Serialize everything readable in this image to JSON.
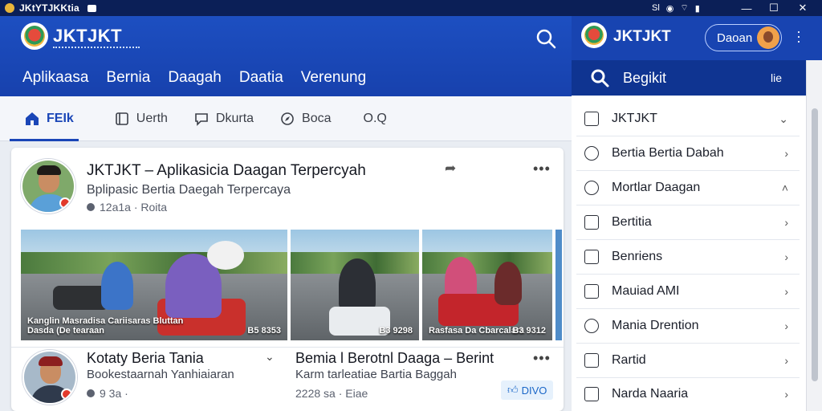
{
  "window": {
    "title": "JKtYTJKKtia",
    "tray": [
      "Sl",
      "wifi",
      "signal"
    ]
  },
  "header": {
    "brand": "JKTJKT",
    "nav": [
      "Aplikaasa",
      "Bernia",
      "Daagah",
      "Daatia",
      "Verenung"
    ]
  },
  "tabs": [
    {
      "label": "FEIk",
      "icon": "home-icon",
      "active": true
    },
    {
      "label": "Uerth",
      "icon": "doc-icon",
      "active": false
    },
    {
      "label": "Dkurta",
      "icon": "comment-icon",
      "active": false
    },
    {
      "label": "Boca",
      "icon": "compass-icon",
      "active": false
    },
    {
      "label": "O.Q",
      "icon": "",
      "active": false
    }
  ],
  "post1": {
    "title": "JKTJKT – Aplikasicia Daagan Terpercyah",
    "subtitle": "Bplipasic Bertia Daegah Terpercaya",
    "meta": "12a1a · Roita",
    "photos": [
      {
        "caption": "Kanglin Masradisa Cariisaras Bluttan",
        "caption2": "Dasda (De tearaan",
        "number": "B5 8353"
      },
      {
        "caption": "",
        "number": "B3 9298"
      },
      {
        "caption": "Rasfasa Da Cbarcalara",
        "number": "B3 9312"
      }
    ]
  },
  "post2": {
    "left": {
      "title": "Kotaty Beria Tania",
      "subtitle": "Bookestaarnah Yanhiaiaran",
      "meta": "9 3a ·"
    },
    "right": {
      "title": "Bemia l Berotnl Daaga – Berint",
      "subtitle": "Karm tarleatiae Bartia Baggah",
      "meta": "2228 sa · Eiae",
      "badge": "DIVO"
    }
  },
  "right_panel": {
    "brand": "JKTJKT",
    "account": "Daoan",
    "search_label": "Begikit",
    "search_right": "lie",
    "items": [
      {
        "label": "JKTJKT",
        "icon": "list-icon"
      },
      {
        "label": "Bertia Bertia Dabah",
        "icon": "location-icon"
      },
      {
        "label": "Mortlar Daagan",
        "icon": "game-icon"
      },
      {
        "label": "Bertitia",
        "icon": "chart-icon"
      },
      {
        "label": "Benriens",
        "icon": "square-icon"
      },
      {
        "label": "Mauiad AMI",
        "icon": "bookmark-icon"
      },
      {
        "label": "Mania Drention",
        "icon": "map-icon"
      },
      {
        "label": "Rartid",
        "icon": "file-icon"
      },
      {
        "label": "Narda Naaria",
        "icon": "calendar-icon"
      }
    ]
  },
  "colors": {
    "header_blue": "#1d4fc1",
    "accent_blue": "#1a46b7",
    "badge_red": "#e23a2c"
  }
}
